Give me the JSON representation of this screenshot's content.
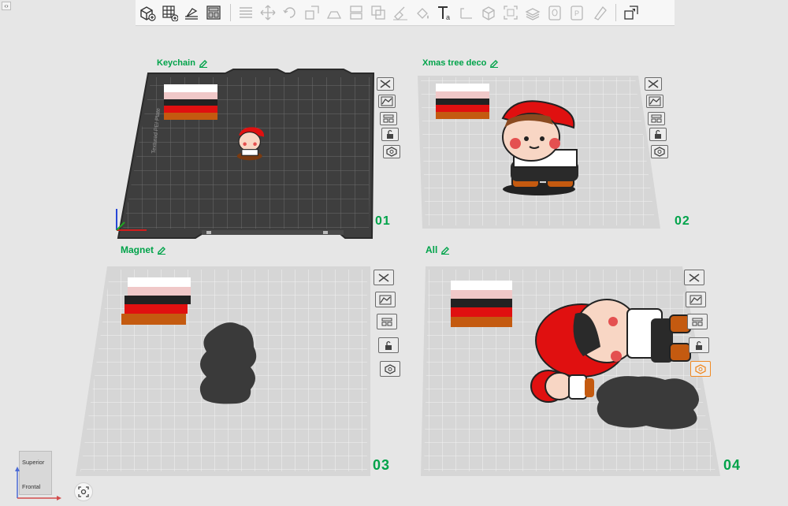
{
  "app": {
    "corner_toggle": "‹›"
  },
  "toolbar": {
    "tools": [
      {
        "name": "add-object-icon",
        "enabled": true
      },
      {
        "name": "add-plate-icon",
        "enabled": true
      },
      {
        "name": "auto-orient-icon",
        "enabled": true
      },
      {
        "name": "arrange-icon",
        "enabled": true
      },
      {
        "name": "layers-icon",
        "enabled": false
      },
      {
        "name": "move-icon",
        "enabled": false
      },
      {
        "name": "rotate-icon",
        "enabled": false
      },
      {
        "name": "scale-icon",
        "enabled": false
      },
      {
        "name": "lay-on-face-icon",
        "enabled": false
      },
      {
        "name": "cut-icon",
        "enabled": false
      },
      {
        "name": "boolean-icon",
        "enabled": false
      },
      {
        "name": "support-paint-icon",
        "enabled": false
      },
      {
        "name": "color-paint-icon",
        "enabled": false
      },
      {
        "name": "text-icon",
        "enabled": true
      },
      {
        "name": "measure-icon",
        "enabled": false
      },
      {
        "name": "assembly-icon",
        "enabled": false
      },
      {
        "name": "fit-view-icon",
        "enabled": false
      },
      {
        "name": "variable-layer-icon",
        "enabled": false
      },
      {
        "name": "split-objects-icon",
        "enabled": false
      },
      {
        "name": "split-parts-icon",
        "enabled": false
      },
      {
        "name": "brim-ears-icon",
        "enabled": false
      },
      {
        "name": "shell-icon",
        "enabled": true
      }
    ]
  },
  "plates": [
    {
      "label": "Keychain",
      "number": "01"
    },
    {
      "label": "Xmas tree deco",
      "number": "02"
    },
    {
      "label": "Magnet",
      "number": "03"
    },
    {
      "label": "All",
      "number": "04"
    }
  ],
  "plate1_bed_text": "Textured PEI Plate",
  "view_cube": {
    "top": "Superior",
    "front": "Frontal"
  },
  "colors": {
    "accent_green": "#00a34a",
    "filament_white": "#ffffff",
    "filament_pink": "#f0c8c8",
    "filament_black": "#222222",
    "filament_red": "#e01010",
    "filament_brown": "#c45a10",
    "plate_active_orange": "#f08a24"
  }
}
